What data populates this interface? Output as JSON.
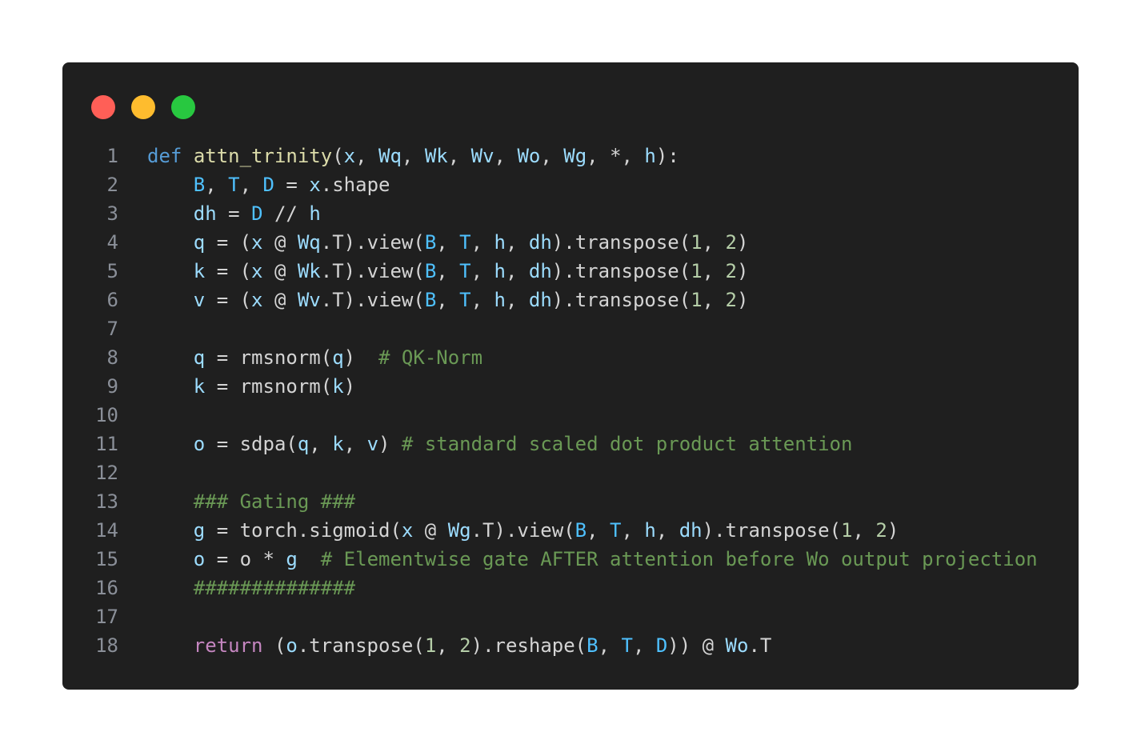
{
  "window": {
    "buttons": [
      {
        "name": "close",
        "color": "#ff5f57"
      },
      {
        "name": "minimize",
        "color": "#febc2e"
      },
      {
        "name": "zoom",
        "color": "#28c840"
      }
    ]
  },
  "code": {
    "language": "python",
    "lines": [
      {
        "num": "1",
        "tokens": [
          {
            "t": "def",
            "c": "kw"
          },
          {
            "t": " ",
            "c": "plain"
          },
          {
            "t": "attn_trinity",
            "c": "fn"
          },
          {
            "t": "(",
            "c": "plain"
          },
          {
            "t": "x",
            "c": "var"
          },
          {
            "t": ", ",
            "c": "plain"
          },
          {
            "t": "Wq",
            "c": "var"
          },
          {
            "t": ", ",
            "c": "plain"
          },
          {
            "t": "Wk",
            "c": "var"
          },
          {
            "t": ", ",
            "c": "plain"
          },
          {
            "t": "Wv",
            "c": "var"
          },
          {
            "t": ", ",
            "c": "plain"
          },
          {
            "t": "Wo",
            "c": "var"
          },
          {
            "t": ", ",
            "c": "plain"
          },
          {
            "t": "Wg",
            "c": "var"
          },
          {
            "t": ", *, ",
            "c": "plain"
          },
          {
            "t": "h",
            "c": "var"
          },
          {
            "t": "):",
            "c": "plain"
          }
        ]
      },
      {
        "num": "2",
        "tokens": [
          {
            "t": "    ",
            "c": "plain"
          },
          {
            "t": "B",
            "c": "const"
          },
          {
            "t": ", ",
            "c": "plain"
          },
          {
            "t": "T",
            "c": "const"
          },
          {
            "t": ", ",
            "c": "plain"
          },
          {
            "t": "D",
            "c": "const"
          },
          {
            "t": " = ",
            "c": "plain"
          },
          {
            "t": "x",
            "c": "var"
          },
          {
            "t": ".shape",
            "c": "plain"
          }
        ]
      },
      {
        "num": "3",
        "tokens": [
          {
            "t": "    ",
            "c": "plain"
          },
          {
            "t": "dh",
            "c": "var"
          },
          {
            "t": " = ",
            "c": "plain"
          },
          {
            "t": "D",
            "c": "const"
          },
          {
            "t": " // ",
            "c": "plain"
          },
          {
            "t": "h",
            "c": "var"
          }
        ]
      },
      {
        "num": "4",
        "tokens": [
          {
            "t": "    ",
            "c": "plain"
          },
          {
            "t": "q",
            "c": "var"
          },
          {
            "t": " = (",
            "c": "plain"
          },
          {
            "t": "x",
            "c": "var"
          },
          {
            "t": " @ ",
            "c": "plain"
          },
          {
            "t": "Wq",
            "c": "var"
          },
          {
            "t": ".T).view(",
            "c": "plain"
          },
          {
            "t": "B",
            "c": "const"
          },
          {
            "t": ", ",
            "c": "plain"
          },
          {
            "t": "T",
            "c": "const"
          },
          {
            "t": ", ",
            "c": "plain"
          },
          {
            "t": "h",
            "c": "var"
          },
          {
            "t": ", ",
            "c": "plain"
          },
          {
            "t": "dh",
            "c": "var"
          },
          {
            "t": ").transpose(",
            "c": "plain"
          },
          {
            "t": "1",
            "c": "num"
          },
          {
            "t": ", ",
            "c": "plain"
          },
          {
            "t": "2",
            "c": "num"
          },
          {
            "t": ")",
            "c": "plain"
          }
        ]
      },
      {
        "num": "5",
        "tokens": [
          {
            "t": "    ",
            "c": "plain"
          },
          {
            "t": "k",
            "c": "var"
          },
          {
            "t": " = (",
            "c": "plain"
          },
          {
            "t": "x",
            "c": "var"
          },
          {
            "t": " @ ",
            "c": "plain"
          },
          {
            "t": "Wk",
            "c": "var"
          },
          {
            "t": ".T).view(",
            "c": "plain"
          },
          {
            "t": "B",
            "c": "const"
          },
          {
            "t": ", ",
            "c": "plain"
          },
          {
            "t": "T",
            "c": "const"
          },
          {
            "t": ", ",
            "c": "plain"
          },
          {
            "t": "h",
            "c": "var"
          },
          {
            "t": ", ",
            "c": "plain"
          },
          {
            "t": "dh",
            "c": "var"
          },
          {
            "t": ").transpose(",
            "c": "plain"
          },
          {
            "t": "1",
            "c": "num"
          },
          {
            "t": ", ",
            "c": "plain"
          },
          {
            "t": "2",
            "c": "num"
          },
          {
            "t": ")",
            "c": "plain"
          }
        ]
      },
      {
        "num": "6",
        "tokens": [
          {
            "t": "    ",
            "c": "plain"
          },
          {
            "t": "v",
            "c": "var"
          },
          {
            "t": " = (",
            "c": "plain"
          },
          {
            "t": "x",
            "c": "var"
          },
          {
            "t": " @ ",
            "c": "plain"
          },
          {
            "t": "Wv",
            "c": "var"
          },
          {
            "t": ".T).view(",
            "c": "plain"
          },
          {
            "t": "B",
            "c": "const"
          },
          {
            "t": ", ",
            "c": "plain"
          },
          {
            "t": "T",
            "c": "const"
          },
          {
            "t": ", ",
            "c": "plain"
          },
          {
            "t": "h",
            "c": "var"
          },
          {
            "t": ", ",
            "c": "plain"
          },
          {
            "t": "dh",
            "c": "var"
          },
          {
            "t": ").transpose(",
            "c": "plain"
          },
          {
            "t": "1",
            "c": "num"
          },
          {
            "t": ", ",
            "c": "plain"
          },
          {
            "t": "2",
            "c": "num"
          },
          {
            "t": ")",
            "c": "plain"
          }
        ]
      },
      {
        "num": "7",
        "tokens": []
      },
      {
        "num": "8",
        "tokens": [
          {
            "t": "    ",
            "c": "plain"
          },
          {
            "t": "q",
            "c": "var"
          },
          {
            "t": " = rmsnorm(",
            "c": "plain"
          },
          {
            "t": "q",
            "c": "var"
          },
          {
            "t": ")  ",
            "c": "plain"
          },
          {
            "t": "# QK-Norm",
            "c": "cm"
          }
        ]
      },
      {
        "num": "9",
        "tokens": [
          {
            "t": "    ",
            "c": "plain"
          },
          {
            "t": "k",
            "c": "var"
          },
          {
            "t": " = rmsnorm(",
            "c": "plain"
          },
          {
            "t": "k",
            "c": "var"
          },
          {
            "t": ")",
            "c": "plain"
          }
        ]
      },
      {
        "num": "10",
        "tokens": []
      },
      {
        "num": "11",
        "tokens": [
          {
            "t": "    ",
            "c": "plain"
          },
          {
            "t": "o",
            "c": "var"
          },
          {
            "t": " = sdpa(",
            "c": "plain"
          },
          {
            "t": "q",
            "c": "var"
          },
          {
            "t": ", ",
            "c": "plain"
          },
          {
            "t": "k",
            "c": "var"
          },
          {
            "t": ", ",
            "c": "plain"
          },
          {
            "t": "v",
            "c": "var"
          },
          {
            "t": ") ",
            "c": "plain"
          },
          {
            "t": "# standard scaled dot product attention",
            "c": "cm"
          }
        ]
      },
      {
        "num": "12",
        "tokens": []
      },
      {
        "num": "13",
        "tokens": [
          {
            "t": "    ",
            "c": "plain"
          },
          {
            "t": "### Gating ###",
            "c": "cm"
          }
        ]
      },
      {
        "num": "14",
        "tokens": [
          {
            "t": "    ",
            "c": "plain"
          },
          {
            "t": "g",
            "c": "var"
          },
          {
            "t": " = torch.sigmoid(",
            "c": "plain"
          },
          {
            "t": "x",
            "c": "var"
          },
          {
            "t": " @ ",
            "c": "plain"
          },
          {
            "t": "Wg",
            "c": "var"
          },
          {
            "t": ".T).view(",
            "c": "plain"
          },
          {
            "t": "B",
            "c": "const"
          },
          {
            "t": ", ",
            "c": "plain"
          },
          {
            "t": "T",
            "c": "const"
          },
          {
            "t": ", ",
            "c": "plain"
          },
          {
            "t": "h",
            "c": "var"
          },
          {
            "t": ", ",
            "c": "plain"
          },
          {
            "t": "dh",
            "c": "var"
          },
          {
            "t": ").transpose(",
            "c": "plain"
          },
          {
            "t": "1",
            "c": "num"
          },
          {
            "t": ", ",
            "c": "plain"
          },
          {
            "t": "2",
            "c": "num"
          },
          {
            "t": ")",
            "c": "plain"
          }
        ]
      },
      {
        "num": "15",
        "tokens": [
          {
            "t": "    ",
            "c": "plain"
          },
          {
            "t": "o",
            "c": "var"
          },
          {
            "t": " = o * ",
            "c": "plain"
          },
          {
            "t": "g",
            "c": "var"
          },
          {
            "t": "  ",
            "c": "plain"
          },
          {
            "t": "# Elementwise gate AFTER attention before Wo output projection",
            "c": "cm"
          }
        ]
      },
      {
        "num": "16",
        "tokens": [
          {
            "t": "    ",
            "c": "plain"
          },
          {
            "t": "##############",
            "c": "cm"
          }
        ]
      },
      {
        "num": "17",
        "tokens": []
      },
      {
        "num": "18",
        "tokens": [
          {
            "t": "    ",
            "c": "plain"
          },
          {
            "t": "return",
            "c": "ret"
          },
          {
            "t": " (",
            "c": "plain"
          },
          {
            "t": "o",
            "c": "var"
          },
          {
            "t": ".transpose(",
            "c": "plain"
          },
          {
            "t": "1",
            "c": "num"
          },
          {
            "t": ", ",
            "c": "plain"
          },
          {
            "t": "2",
            "c": "num"
          },
          {
            "t": ").reshape(",
            "c": "plain"
          },
          {
            "t": "B",
            "c": "const"
          },
          {
            "t": ", ",
            "c": "plain"
          },
          {
            "t": "T",
            "c": "const"
          },
          {
            "t": ", ",
            "c": "plain"
          },
          {
            "t": "D",
            "c": "const"
          },
          {
            "t": ")) @ ",
            "c": "plain"
          },
          {
            "t": "Wo",
            "c": "var"
          },
          {
            "t": ".T",
            "c": "plain"
          }
        ]
      }
    ]
  }
}
